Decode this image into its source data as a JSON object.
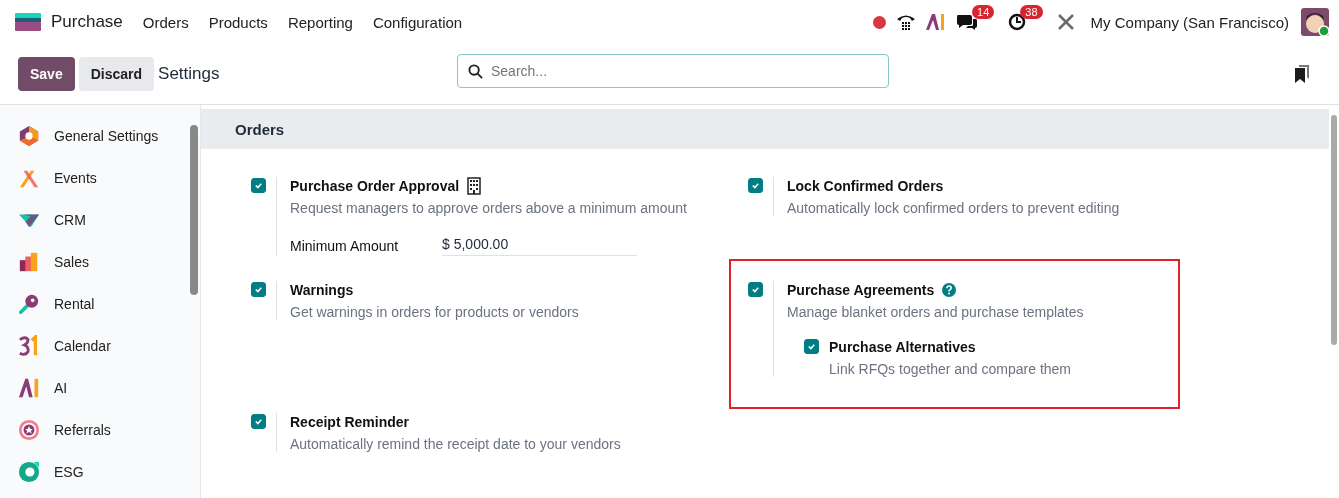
{
  "navbar": {
    "app_name": "Purchase",
    "menu": [
      "Orders",
      "Products",
      "Reporting",
      "Configuration"
    ],
    "messages_count": "14",
    "activities_count": "38",
    "company": "My Company (San Francisco)"
  },
  "control_panel": {
    "buttons": [
      "Save",
      "Discard"
    ],
    "title": "Settings",
    "search": {
      "placeholder": "Search..."
    }
  },
  "sidebar": {
    "items": [
      "General Settings",
      "Events",
      "CRM",
      "Sales",
      "Rental",
      "Calendar",
      "AI",
      "Referrals",
      "ESG"
    ]
  },
  "section": {
    "title": "Orders",
    "settings": [
      {
        "title": "Purchase Order Approval",
        "company_icon": true,
        "help_icon": false,
        "description": "Request managers to approve orders above a minimum amount",
        "checked": true,
        "highlighted": false,
        "field": {
          "label": "Minimum Amount",
          "value": "$ 5,000.00"
        }
      },
      {
        "title": "Lock Confirmed Orders",
        "company_icon": false,
        "help_icon": false,
        "description": "Automatically lock confirmed orders to prevent editing",
        "checked": true,
        "highlighted": false
      },
      {
        "title": "Warnings",
        "company_icon": false,
        "help_icon": false,
        "description": "Get warnings in orders for products or vendors",
        "checked": true,
        "highlighted": false
      },
      {
        "title": "Purchase Agreements",
        "company_icon": false,
        "help_icon": true,
        "description": "Manage blanket orders and purchase templates",
        "checked": true,
        "highlighted": true,
        "children": [
          {
            "title": "Purchase Alternatives",
            "description": "Link RFQs together and compare them",
            "checked": true
          }
        ]
      },
      {
        "title": "Receipt Reminder",
        "company_icon": false,
        "help_icon": false,
        "description": "Automatically remind the receipt date to your vendors",
        "checked": true,
        "highlighted": false
      }
    ]
  }
}
